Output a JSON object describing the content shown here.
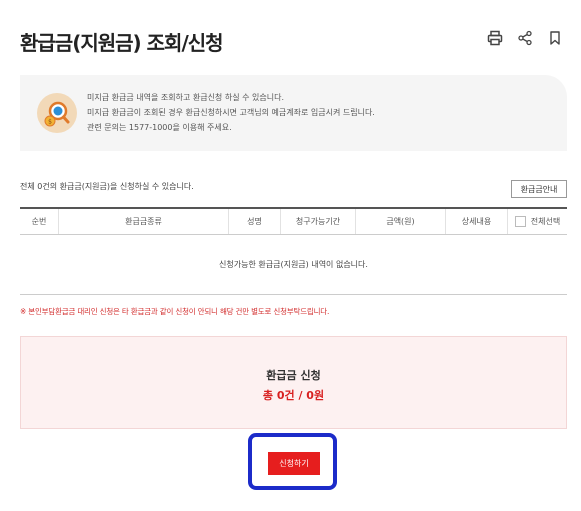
{
  "page": {
    "title": "환급금(지원금) 조회/신청"
  },
  "tools": [
    {
      "icon": "print-icon"
    },
    {
      "icon": "share-icon"
    },
    {
      "icon": "bookmark-icon"
    }
  ],
  "info": {
    "icon": "magnifier-coin-icon",
    "lines": [
      "미지급 환급금 내역을 조회하고 환급신청 하실 수 있습니다.",
      "미지급 환급금이 조회된 경우 환급신청하시면 고객님의 예금계좌로 입금시켜 드립니다.",
      "관련 문의는 1577-1000을 이용해 주세요."
    ]
  },
  "list": {
    "count_text": "전체 0건의 환급금(지원금)을 신청하실 수 있습니다.",
    "guide_button": "환급금안내",
    "headers": [
      "순번",
      "환급금종류",
      "성명",
      "청구가능기간",
      "금액(원)",
      "상세내용",
      "전체선택"
    ],
    "empty_text": "신청가능한 환급금(지원금) 내역이 없습니다."
  },
  "notice": "※ 본인부담환급금 대리인 신청은 타 환급금과 같이 신청이 안되니 해당 건만 별도로 신청부탁드립니다.",
  "summary": {
    "title": "환급금 신청",
    "total": "총 0건 / 0원"
  },
  "apply_button": "신청하기",
  "colors": {
    "accent": "#e61e1e",
    "highlight": "#1c2bc9",
    "summary_bg": "#fdf1f1"
  }
}
